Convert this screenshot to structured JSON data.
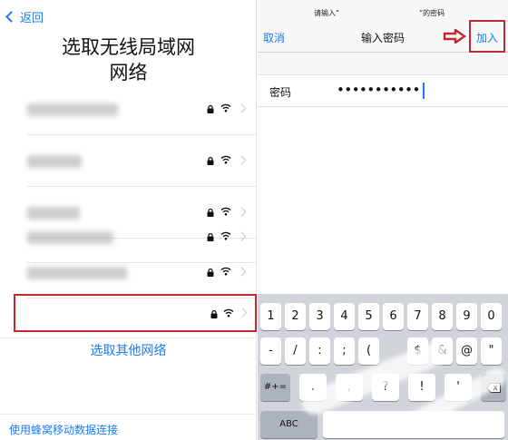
{
  "left": {
    "back_label": "返回",
    "title_line1": "选取无线局域网",
    "title_line2": "网络",
    "networks_count_visible": 6,
    "other_label": "选取其他网络",
    "cellular_label": "使用蜂窝移动数据连接"
  },
  "right": {
    "prompt_left": "请输入“",
    "prompt_right": "”的密码",
    "cancel_label": "取消",
    "title": "输入密码",
    "join_label": "加入",
    "password_label": "密码",
    "password_value": "•••••••••••",
    "keyboard": {
      "row1": [
        "1",
        "2",
        "3",
        "4",
        "5",
        "6",
        "7",
        "8",
        "9",
        "0"
      ],
      "row2": [
        "-",
        "/",
        ":",
        ";",
        "(",
        "$",
        "&",
        "@",
        "\""
      ],
      "row3": [
        ".",
        ",",
        "?",
        "!",
        "'"
      ],
      "symbols_label": "#+=",
      "abc_label": "ABC"
    }
  },
  "colors": {
    "accent": "#1a7cf5",
    "highlight": "#c0292d"
  }
}
